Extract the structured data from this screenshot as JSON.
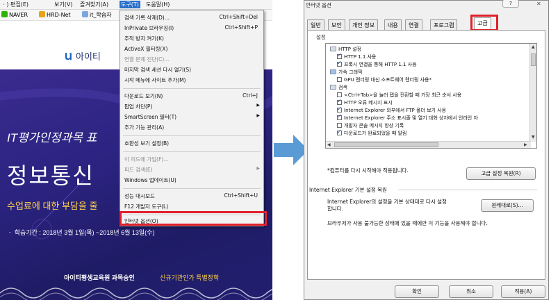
{
  "browser": {
    "menubar": [
      {
        "label": "ㆍ) 편집(E)"
      },
      {
        "label": "보기(V)"
      },
      {
        "label": "즐겨찾기(A)"
      },
      {
        "label": "도구(T)"
      },
      {
        "label": "도움말(H)"
      }
    ],
    "favorites": [
      {
        "label": "NAVER"
      },
      {
        "label": "HRD-Net"
      },
      {
        "label": "it_학습자"
      }
    ],
    "page": {
      "logo_text": "아이티",
      "banner_line1": "IT평가인정과목 표",
      "banner_line2": "정보통신",
      "banner_line3": "수업료에 대한 부담을 줄",
      "banner_line4": "ㆍ 학습기간 : 2018년 3월 1일(목) ~2018년 6월 13일(수)",
      "footer_left": "아이티평생교육원 과목승인",
      "footer_right": "신규기관인가 특별장학"
    }
  },
  "tools_menu": {
    "items": [
      {
        "label": "검색 기록 삭제(D)...",
        "shortcut": "Ctrl+Shift+Del"
      },
      {
        "label": "InPrivate 브라우징(I)",
        "shortcut": "Ctrl+Shift+P"
      },
      {
        "label": "추적 방지 켜기(K)",
        "shortcut": ""
      },
      {
        "label": "ActiveX 필터링(X)",
        "shortcut": ""
      },
      {
        "label": "연결 문제 진단(C)...",
        "shortcut": ""
      },
      {
        "label": "마지막 검색 세션 다시 열기(S)",
        "shortcut": ""
      },
      {
        "label": "시작 메뉴에 사이트 추가(M)",
        "shortcut": ""
      },
      {
        "label": "다운로드 보기(N)",
        "shortcut": "Ctrl+J"
      },
      {
        "label": "팝업 차단(P)",
        "shortcut": ""
      },
      {
        "label": "SmartScreen 필터(T)",
        "shortcut": ""
      },
      {
        "label": "추가 기능 관리(A)",
        "shortcut": ""
      },
      {
        "label": "호환성 보기 설정(B)",
        "shortcut": ""
      },
      {
        "label": "이 피드에 가입(F)...",
        "shortcut": ""
      },
      {
        "label": "피드 검색(E)",
        "shortcut": ""
      },
      {
        "label": "Windows 업데이트(U)",
        "shortcut": ""
      },
      {
        "label": "성능 대시보드",
        "shortcut": "Ctrl+Shift+U"
      },
      {
        "label": "F12 개발자 도구(L)",
        "shortcut": ""
      },
      {
        "label": "인터넷 옵션(O)",
        "shortcut": ""
      }
    ]
  },
  "dialog": {
    "title": "인터넷 옵션",
    "help_label": "?",
    "close_label": "✕",
    "tabs": [
      "일반",
      "보안",
      "개인 정보",
      "내용",
      "연결",
      "프로그램",
      "고급"
    ],
    "group_settings": "설정",
    "tree": [
      {
        "type": "folder",
        "label": "HTTP 설정"
      },
      {
        "type": "check",
        "checked": true,
        "label": "HTTP 1.1 사용"
      },
      {
        "type": "check",
        "checked": true,
        "label": "프록시 연결을 통해 HTTP 1.1 사용"
      },
      {
        "type": "folder",
        "label": "가속 그래픽"
      },
      {
        "type": "check",
        "checked": false,
        "label": "GPU 렌더링 대신 소프트웨어 렌더링 사용*"
      },
      {
        "type": "folder",
        "label": "검색"
      },
      {
        "type": "check",
        "checked": false,
        "label": "<Ctrl+Tab>을 눌러 탭을 전환할 때 가장 최근 순서 사용"
      },
      {
        "type": "check",
        "checked": true,
        "label": "HTTP 오류 메시지 표시"
      },
      {
        "type": "check",
        "checked": true,
        "label": "Internet Explorer 외부에서 FTP 폴더 보기 사용"
      },
      {
        "type": "check",
        "checked": true,
        "label": "Internet Explorer 주소 표시줄 및 열기 대화 상자에서 인라인 자"
      },
      {
        "type": "check",
        "checked": false,
        "label": "개발자 콘솔 메시지 항상 기록"
      },
      {
        "type": "check",
        "checked": true,
        "label": "다운로드가 완료되었을 때 알림"
      }
    ],
    "restart_note": "*컴퓨터를 다시 시작해야 적용됩니다.",
    "restore_button": "고급 설정 복원(R)",
    "group_reset": "Internet Explorer 기본 설정 복원",
    "reset_desc_line1": "Internet Explorer의 설정을 기본 상태대로 다시 설정",
    "reset_desc_line2": "합니다.",
    "reset_button": "원래대로(S)...",
    "reset_warning": "브라우저가 사용 불가능한 상태에 있을 때에만 이 기능을 사용해야 합니다.",
    "ok_button": "확인",
    "cancel_button": "취소",
    "apply_button": "적용(A)"
  },
  "colors": {
    "highlight_box": "#e0212b",
    "arrow": "#5b9bd5",
    "banner": "#2b2380"
  }
}
